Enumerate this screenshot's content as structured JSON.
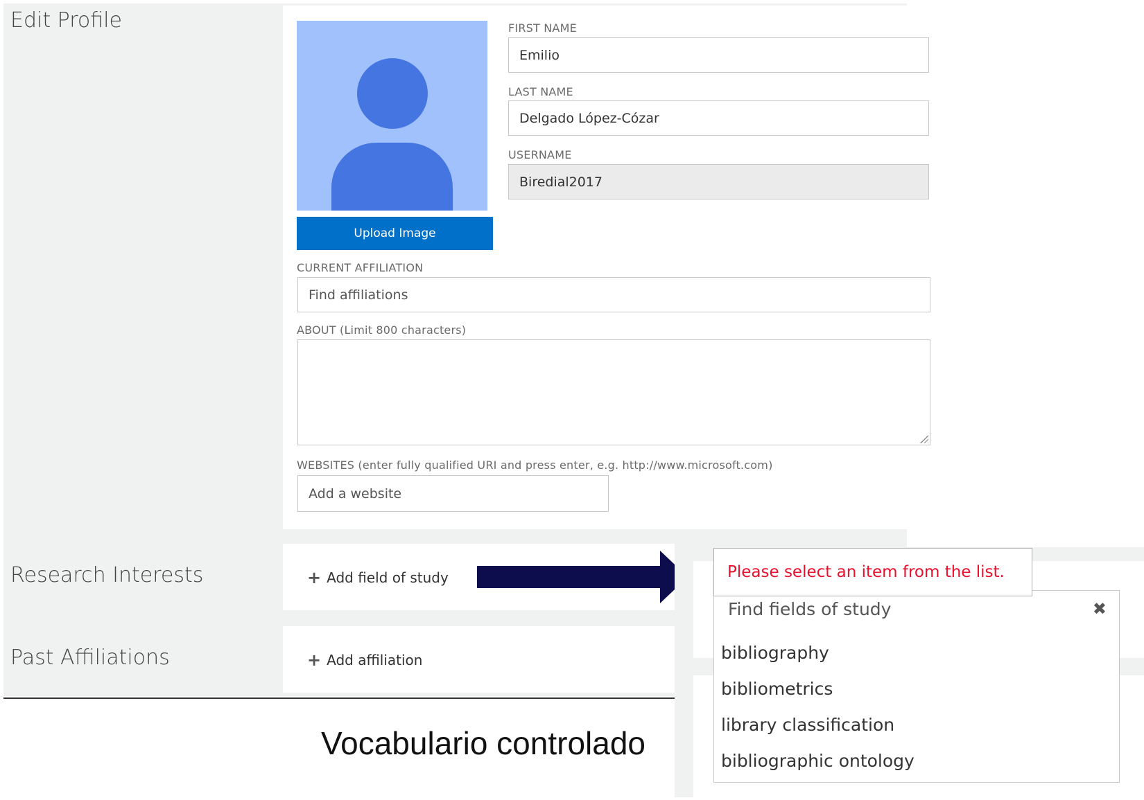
{
  "profile": {
    "title": "Edit Profile",
    "upload_label": "Upload Image",
    "first_name_label": "FIRST NAME",
    "first_name": "Emilio",
    "last_name_label": "LAST NAME",
    "last_name": "Delgado López-Cózar",
    "username_label": "USERNAME",
    "username": "Biredial2017",
    "affiliation_label": "CURRENT AFFILIATION",
    "affiliation_placeholder": "Find affiliations",
    "about_label": "ABOUT (Limit 800 characters)",
    "websites_label": "WEBSITES (enter fully qualified URI and press enter, e.g. http://www.microsoft.com)",
    "website_placeholder": "Add a website"
  },
  "research": {
    "title": "Research Interests",
    "add_label": "Add field of study"
  },
  "past": {
    "title": "Past Affiliations",
    "add_label": "Add affiliation"
  },
  "popup": {
    "error": "Please select an item from the list.",
    "search_placeholder": "Find fields of study",
    "items": [
      "bibliography",
      "bibliometrics",
      "library classification",
      "bibliographic ontology"
    ]
  },
  "caption": "Vocabulario controlado",
  "icons": {
    "avatar": "person-silhouette-icon",
    "plus": "plus-icon",
    "close": "close-icon",
    "arrow": "right-arrow-icon"
  },
  "colors": {
    "primary": "#0170c8",
    "error": "#e8112d",
    "avatar_bg": "#a1c1fd",
    "avatar_fg": "#4575e0",
    "arrow": "#0d0d4d"
  }
}
